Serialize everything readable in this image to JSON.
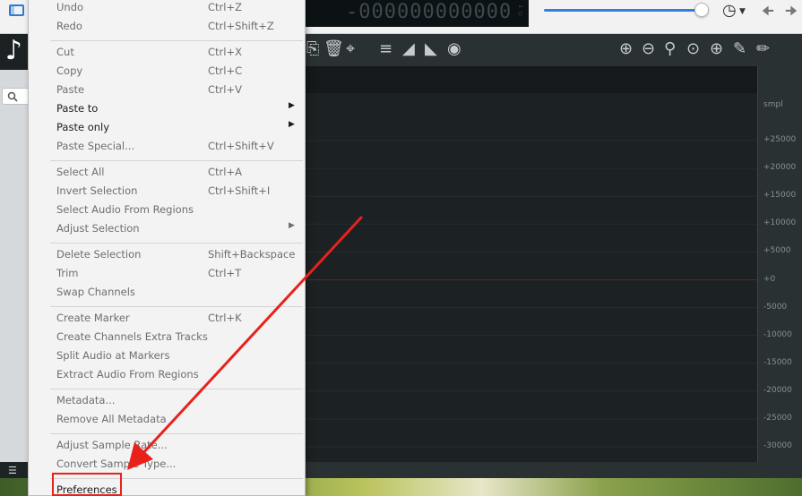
{
  "timecode": "-000000000000",
  "menu": {
    "items": [
      {
        "label": "Undo",
        "shortcut": "Ctrl+Z",
        "enabled": false
      },
      {
        "label": "Redo",
        "shortcut": "Ctrl+Shift+Z",
        "enabled": false
      },
      {
        "label": "Cut",
        "shortcut": "Ctrl+X",
        "enabled": false
      },
      {
        "label": "Copy",
        "shortcut": "Ctrl+C",
        "enabled": false
      },
      {
        "label": "Paste",
        "shortcut": "Ctrl+V",
        "enabled": false
      },
      {
        "label": "Paste to",
        "shortcut": "",
        "enabled": true,
        "submenu": true
      },
      {
        "label": "Paste only",
        "shortcut": "",
        "enabled": true,
        "submenu": true
      },
      {
        "label": "Paste Special...",
        "shortcut": "Ctrl+Shift+V",
        "enabled": false
      },
      {
        "label": "Select All",
        "shortcut": "Ctrl+A",
        "enabled": false
      },
      {
        "label": "Invert Selection",
        "shortcut": "Ctrl+Shift+I",
        "enabled": false
      },
      {
        "label": "Select Audio From Regions",
        "shortcut": "",
        "enabled": false
      },
      {
        "label": "Adjust Selection",
        "shortcut": "",
        "enabled": false,
        "submenu": true
      },
      {
        "label": "Delete Selection",
        "shortcut": "Shift+Backspace",
        "enabled": false
      },
      {
        "label": "Trim",
        "shortcut": "Ctrl+T",
        "enabled": false
      },
      {
        "label": "Swap Channels",
        "shortcut": "",
        "enabled": false
      },
      {
        "label": "Create Marker",
        "shortcut": "Ctrl+K",
        "enabled": false
      },
      {
        "label": "Create Channels Extra Tracks",
        "shortcut": "",
        "enabled": false
      },
      {
        "label": "Split Audio at Markers",
        "shortcut": "",
        "enabled": false
      },
      {
        "label": "Extract Audio From Regions",
        "shortcut": "",
        "enabled": false
      },
      {
        "label": "Metadata...",
        "shortcut": "",
        "enabled": false
      },
      {
        "label": "Remove All Metadata",
        "shortcut": "",
        "enabled": false
      },
      {
        "label": "Adjust Sample Rate...",
        "shortcut": "",
        "enabled": false
      },
      {
        "label": "Convert Sample Type...",
        "shortcut": "",
        "enabled": false
      },
      {
        "label": "Preferences",
        "shortcut": "",
        "enabled": true
      }
    ]
  },
  "axis": {
    "unit": "smpl",
    "ticks": [
      "+25000",
      "+20000",
      "+15000",
      "+10000",
      "+5000",
      "+0",
      "-5000",
      "-10000",
      "-15000",
      "-20000",
      "-25000",
      "-30000"
    ]
  },
  "icons": {
    "toolbar_left": [
      "paste-icon",
      "trash-icon",
      "crop-icon",
      "align-icon",
      "fade-in-icon",
      "fade-out-icon",
      "normalize-icon"
    ],
    "toolbar_right": [
      "zoom-in-icon",
      "zoom-out-icon",
      "zoom-fit-icon",
      "zoom-selection-icon",
      "zoom-all-icon",
      "pencil-icon",
      "eraser-icon"
    ]
  },
  "colors": {
    "accent": "#2f7fe0",
    "highlight": "#e8221b",
    "zero_line": "#6a1f22"
  }
}
